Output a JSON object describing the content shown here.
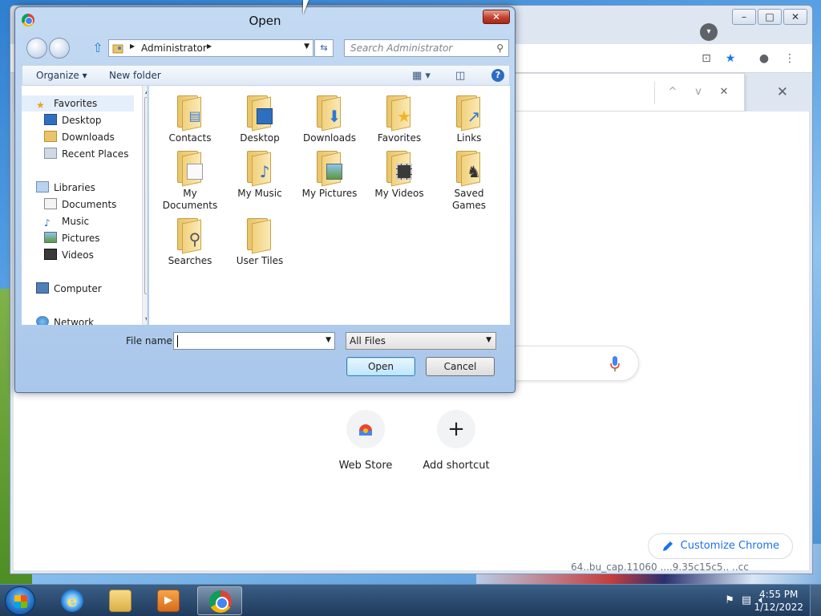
{
  "chrome": {
    "status_text": "64..bu_cap.11060 ....9.35c15c5.. ..cc",
    "shortcuts": [
      {
        "label": "Web Store",
        "icon": "web-store-icon"
      },
      {
        "label": "Add shortcut",
        "icon": "plus-icon",
        "glyph": "+"
      }
    ],
    "customize_label": "Customize Chrome",
    "findbar": {
      "prev": "^",
      "next": "v",
      "close": "✕"
    }
  },
  "dialog": {
    "title": "Open",
    "close_glyph": "✕",
    "address": {
      "path": "Administrator"
    },
    "search_placeholder": "Search Administrator",
    "toolbar": {
      "organize": "Organize ▾",
      "new_folder": "New folder",
      "help": "?"
    },
    "nav": {
      "favorites_header": "Favorites",
      "favorites": [
        "Desktop",
        "Downloads",
        "Recent Places"
      ],
      "libraries_header": "Libraries",
      "libraries": [
        "Documents",
        "Music",
        "Pictures",
        "Videos"
      ],
      "computer": "Computer",
      "network": "Network"
    },
    "items": [
      {
        "label": "Contacts",
        "badge": "contacts-icon"
      },
      {
        "label": "Desktop",
        "badge": "desktop-icon"
      },
      {
        "label": "Downloads",
        "badge": "download-arrow-icon"
      },
      {
        "label": "Favorites",
        "badge": "star-icon"
      },
      {
        "label": "Links",
        "badge": "link-arrow-icon"
      },
      {
        "label": "My Documents",
        "badge": "document-icon"
      },
      {
        "label": "My Music",
        "badge": "music-note-icon"
      },
      {
        "label": "My Pictures",
        "badge": "picture-icon"
      },
      {
        "label": "My Videos",
        "badge": "film-icon"
      },
      {
        "label": "Saved Games",
        "badge": "chess-piece-icon"
      },
      {
        "label": "Searches",
        "badge": "magnifier-icon"
      },
      {
        "label": "User Tiles",
        "badge": "folder-icon"
      }
    ],
    "file_name_label": "File name:",
    "file_name_value": "",
    "file_type": "All Files",
    "open_label": "Open",
    "cancel_label": "Cancel"
  },
  "taskbar": {
    "apps": [
      "internet-explorer",
      "windows-explorer",
      "windows-media-player",
      "google-chrome"
    ],
    "active_app": "google-chrome",
    "time": "4:55 PM",
    "date": "1/12/2022"
  },
  "colors": {
    "accent": "#1a73e8",
    "taskbar": "#1f3a5c",
    "dialog_frame": "#a9c7eb"
  }
}
